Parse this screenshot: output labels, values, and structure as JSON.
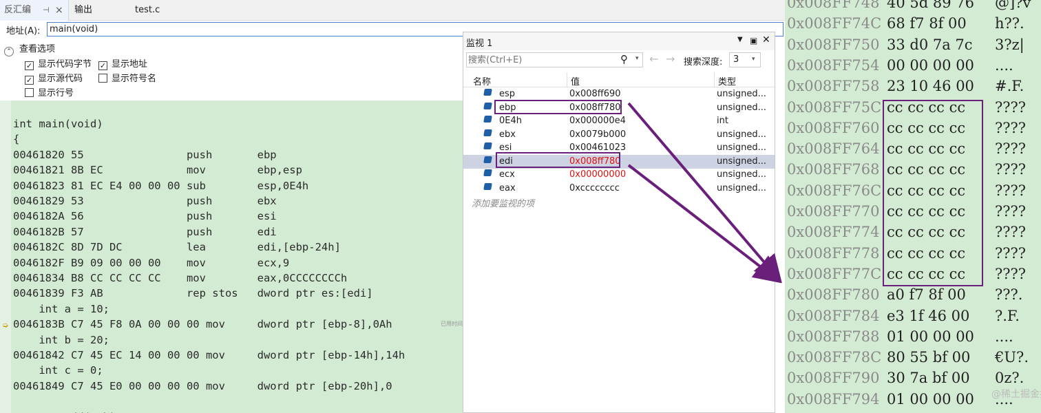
{
  "tabs": [
    {
      "label": "反汇编",
      "pin": "⊣",
      "close": "×"
    },
    {
      "label": "输出"
    },
    {
      "label": "test.c"
    }
  ],
  "address": {
    "label": "地址(A):",
    "value": "main(void)"
  },
  "view_options": {
    "title": "查看选项",
    "items": [
      {
        "label": "显示代码字节",
        "checked": true
      },
      {
        "label": "显示地址",
        "checked": true
      },
      {
        "label": "显示源代码",
        "checked": true
      },
      {
        "label": "显示符号名",
        "checked": false
      },
      {
        "label": "显示行号",
        "checked": false
      }
    ]
  },
  "disassembly": {
    "lines": [
      "int main(void)",
      "{",
      "00461820 55                push       ebp",
      "00461821 8B EC             mov        ebp,esp",
      "00461823 81 EC E4 00 00 00 sub        esp,0E4h",
      "00461829 53                push       ebx",
      "0046182A 56                push       esi",
      "0046182B 57                push       edi",
      "0046182C 8D 7D DC          lea        edi,[ebp-24h]",
      "0046182F B9 09 00 00 00    mov        ecx,9",
      "00461834 B8 CC CC CC CC    mov        eax,0CCCCCCCCh",
      "00461839 F3 AB             rep stos   dword ptr es:[edi]",
      "    int a = 10;",
      "0046183B C7 45 F8 0A 00 00 00 mov     dword ptr [ebp-8],0Ah",
      "    int b = 20;",
      "00461842 C7 45 EC 14 00 00 00 mov     dword ptr [ebp-14h],14h",
      "    int c = 0;",
      "00461849 C7 45 E0 00 00 00 00 mov     dword ptr [ebp-20h],0",
      "",
      "    c = Add(a,b);"
    ],
    "current_line_index": 13,
    "elapsed_note": "已用时间"
  },
  "watch": {
    "title": "监视 1",
    "search_placeholder": "搜索(Ctrl+E)",
    "depth_label": "搜索深度:",
    "depth_value": "3",
    "columns": [
      "名称",
      "值",
      "类型"
    ],
    "rows": [
      {
        "name": "esp",
        "value": "0x008ff690",
        "type": "unsigned...",
        "changed": false
      },
      {
        "name": "ebp",
        "value": "0x008ff780",
        "type": "unsigned...",
        "changed": false
      },
      {
        "name": "0E4h",
        "value": "0x000000e4",
        "type": "int",
        "changed": false
      },
      {
        "name": "ebx",
        "value": "0x0079b000",
        "type": "unsigned...",
        "changed": false
      },
      {
        "name": "esi",
        "value": "0x00461023",
        "type": "unsigned...",
        "changed": false
      },
      {
        "name": "edi",
        "value": "0x008ff780",
        "type": "unsigned...",
        "changed": true
      },
      {
        "name": "ecx",
        "value": "0x00000000",
        "type": "unsigned...",
        "changed": true
      },
      {
        "name": "eax",
        "value": "0xcccccccc",
        "type": "unsigned...",
        "changed": false
      }
    ],
    "add_hint": "添加要监视的项",
    "selected_row_index": 5
  },
  "memory": {
    "rows": [
      {
        "addr": "0x008FF748",
        "bytes": "40 5d 89 76",
        "ascii": "@]?v"
      },
      {
        "addr": "0x008FF74C",
        "bytes": "68 f7 8f 00",
        "ascii": "h??."
      },
      {
        "addr": "0x008FF750",
        "bytes": "33 d0 7a 7c",
        "ascii": "3?z|"
      },
      {
        "addr": "0x008FF754",
        "bytes": "00 00 00 00",
        "ascii": "...."
      },
      {
        "addr": "0x008FF758",
        "bytes": "23 10 46 00",
        "ascii": "#.F."
      },
      {
        "addr": "0x008FF75C",
        "bytes": "cc cc cc cc",
        "ascii": "????"
      },
      {
        "addr": "0x008FF760",
        "bytes": "cc cc cc cc",
        "ascii": "????"
      },
      {
        "addr": "0x008FF764",
        "bytes": "cc cc cc cc",
        "ascii": "????"
      },
      {
        "addr": "0x008FF768",
        "bytes": "cc cc cc cc",
        "ascii": "????"
      },
      {
        "addr": "0x008FF76C",
        "bytes": "cc cc cc cc",
        "ascii": "????"
      },
      {
        "addr": "0x008FF770",
        "bytes": "cc cc cc cc",
        "ascii": "????"
      },
      {
        "addr": "0x008FF774",
        "bytes": "cc cc cc cc",
        "ascii": "????"
      },
      {
        "addr": "0x008FF778",
        "bytes": "cc cc cc cc",
        "ascii": "????"
      },
      {
        "addr": "0x008FF77C",
        "bytes": "cc cc cc cc",
        "ascii": "????"
      },
      {
        "addr": "0x008FF780",
        "bytes": "a0 f7 8f 00",
        "ascii": "???."
      },
      {
        "addr": "0x008FF784",
        "bytes": "e3 1f 46 00",
        "ascii": "?.F."
      },
      {
        "addr": "0x008FF788",
        "bytes": "01 00 00 00",
        "ascii": "...."
      },
      {
        "addr": "0x008FF78C",
        "bytes": "80 55 bf 00",
        "ascii": "€U?."
      },
      {
        "addr": "0x008FF790",
        "bytes": "30 7a bf 00",
        "ascii": "0z?."
      },
      {
        "addr": "0x008FF794",
        "bytes": "01 00 00 00",
        "ascii": "...."
      }
    ]
  },
  "watermark": "@稀土掘金技术社区",
  "colors": {
    "annotation": "#6a1f7a",
    "changed_value": "#e01010",
    "accent": "#4c7dd1"
  }
}
